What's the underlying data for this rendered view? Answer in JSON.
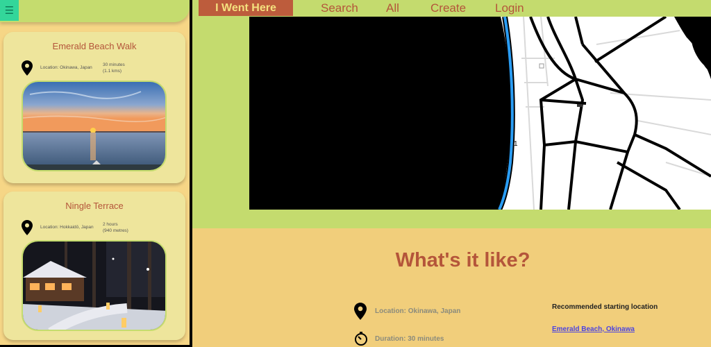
{
  "sidebar": {
    "menu_icon": "hamburger-icon",
    "cards": [
      {
        "title": "Emerald Beach Walk",
        "location": "Location: Okinawa, Japan",
        "duration_line1": "30 minutes",
        "duration_line2": "(1.1 kms)",
        "photo": "sunset over the sea"
      },
      {
        "title": "Ningle Terrace",
        "location": "Location: Hokkaidō, Japan",
        "duration_line1": "2 hours",
        "duration_line2": "(940 metres)",
        "photo": "snowy forest cabins at night"
      }
    ]
  },
  "navbar": {
    "brand": "I Went Here",
    "links": [
      "Search",
      "All",
      "Create",
      "Login"
    ]
  },
  "map": {
    "route_color": "#2a9df4",
    "road_label": "1"
  },
  "info": {
    "heading": "What's it like?",
    "location": "Location: Okinawa, Japan",
    "duration": "Duration: 30 minutes",
    "recommended_label": "Recommended starting location",
    "recommended_link": "Emerald Beach, Okinawa"
  },
  "colors": {
    "accent_green": "#c4db6e",
    "brand_rust": "#bd5c3c",
    "card_bg": "#eee59c",
    "sand": "#f1ce7b"
  }
}
